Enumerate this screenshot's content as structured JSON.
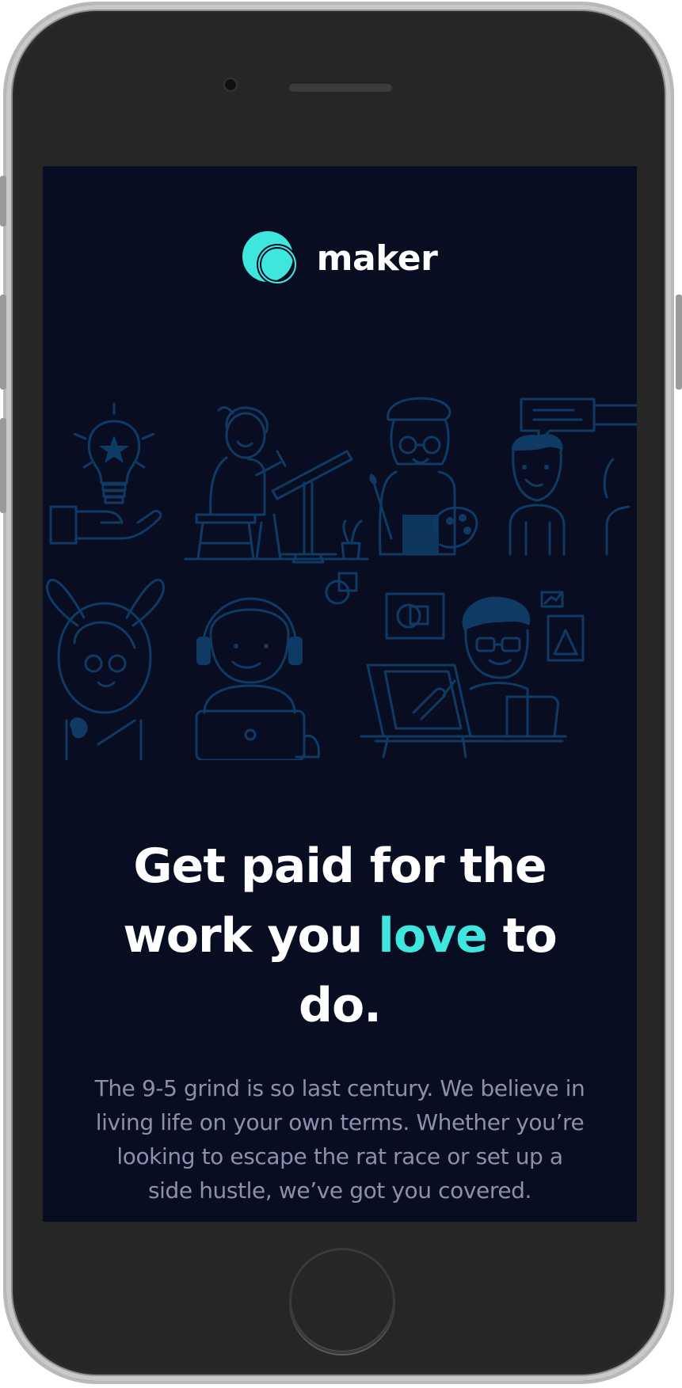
{
  "brand": {
    "name": "maker",
    "accent_color": "#3ee6dd",
    "background_color": "#090d22"
  },
  "hero": {
    "headline_before": "Get paid for the work you ",
    "headline_accent": "love",
    "headline_after": " to do.",
    "body": "The 9-5 grind is so last century. We believe in living life on your own terms. Whether you’re looking to escape the rat race or set up a side hustle, we’ve got you covered."
  },
  "illustration": {
    "figures": [
      "lightbulb-hand",
      "artist-at-drafting-table",
      "painter-with-palette",
      "person-with-speech-bubble",
      "bunny-costume-character",
      "headset-laptop-worker",
      "designer-at-drawing-tablet"
    ]
  }
}
